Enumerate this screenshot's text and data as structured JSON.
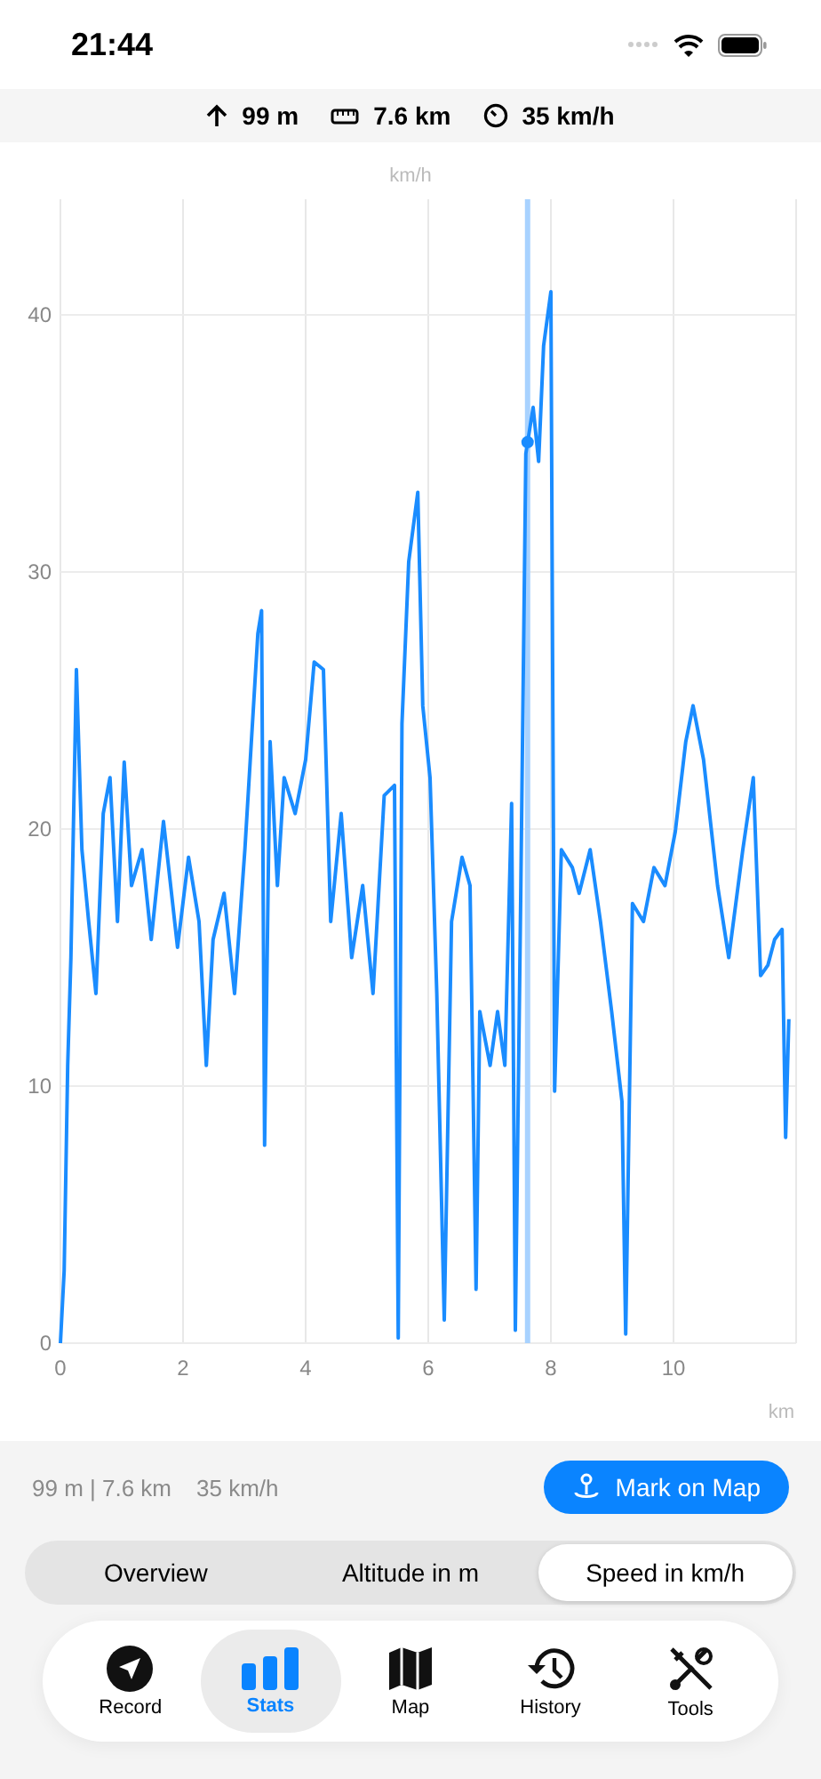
{
  "status_bar": {
    "time": "21:44"
  },
  "summary": [
    {
      "kind": "altitude",
      "text": "99 m"
    },
    {
      "kind": "distance",
      "text": "7.6 km"
    },
    {
      "kind": "speed",
      "text": "35 km/h"
    }
  ],
  "chart": {
    "chart_data": {
      "type": "line",
      "ylabel": "km/h",
      "xlabel": "km",
      "x": [
        0,
        0.06,
        0.12,
        0.17,
        0.26,
        0.35,
        0.46,
        0.58,
        0.7,
        0.81,
        0.93,
        1.04,
        1.16,
        1.33,
        1.48,
        1.68,
        1.91,
        2.09,
        2.26,
        2.38,
        2.49,
        2.67,
        2.84,
        3.01,
        3.22,
        3.28,
        3.33,
        3.42,
        3.54,
        3.65,
        3.83,
        4.0,
        4.14,
        4.29,
        4.41,
        4.58,
        4.75,
        4.93,
        5.1,
        5.28,
        5.45,
        5.51,
        5.57,
        5.68,
        5.83,
        5.91,
        6.03,
        6.14,
        6.26,
        6.38,
        6.55,
        6.68,
        6.78,
        6.84,
        7.01,
        7.13,
        7.25,
        7.36,
        7.42,
        7.51,
        7.59,
        7.71,
        7.8,
        7.88,
        8.0,
        8.06,
        8.17,
        8.35,
        8.46,
        8.64,
        8.81,
        8.99,
        9.16,
        9.22,
        9.33,
        9.51,
        9.68,
        9.86,
        10.03,
        10.2,
        10.32,
        10.49,
        10.72,
        10.9,
        11.13,
        11.3,
        11.42,
        11.54,
        11.65,
        11.77,
        11.83,
        11.88
      ],
      "series": [
        {
          "color": "#1a8cff",
          "values": [
            0,
            2.8,
            10.8,
            15,
            26.2,
            19.2,
            16.4,
            13.6,
            20.6,
            22,
            16.4,
            22.6,
            17.8,
            19.2,
            15.7,
            20.3,
            15.4,
            18.9,
            16.4,
            10.8,
            15.7,
            17.5,
            13.6,
            19.2,
            27.6,
            28.5,
            7.7,
            23.4,
            17.8,
            22,
            20.6,
            22.7,
            26.5,
            26.2,
            16.4,
            20.6,
            15,
            17.8,
            13.6,
            21.3,
            21.7,
            0.2,
            24.1,
            30.4,
            33.1,
            24.8,
            22,
            13.6,
            0.9,
            16.4,
            18.9,
            17.8,
            2.1,
            12.9,
            10.8,
            12.9,
            10.8,
            21,
            0.5,
            17.8,
            34.6,
            36.4,
            34.3,
            38.8,
            40.9,
            9.8,
            19.2,
            18.5,
            17.5,
            19.2,
            16.4,
            12.9,
            9.4,
            0.35,
            17.1,
            16.4,
            18.5,
            17.8,
            19.9,
            23.4,
            24.8,
            22.7,
            17.8,
            15,
            19.2,
            22,
            14.3,
            14.7,
            15.7,
            16.1,
            8,
            12.6
          ]
        }
      ],
      "xlim": [
        0,
        12
      ],
      "ylim": [
        0,
        44.5
      ],
      "xticks": [
        0,
        2,
        4,
        6,
        8,
        10
      ],
      "yticks": [
        0,
        10,
        20,
        30,
        40
      ],
      "grid": true,
      "ref_lines": [
        {
          "axis": "x",
          "value": 7.62
        }
      ]
    }
  },
  "info": {
    "position": "99 m | 7.6 km",
    "speed": "35 km/h"
  },
  "mark_button": "Mark on Map",
  "segments": [
    {
      "label": "Overview",
      "selected": false
    },
    {
      "label": "Altitude in m",
      "selected": false
    },
    {
      "label": "Speed in km/h",
      "selected": true
    }
  ],
  "tabs": [
    {
      "kind": "record",
      "label": "Record",
      "selected": false
    },
    {
      "kind": "stats",
      "label": "Stats",
      "selected": true
    },
    {
      "kind": "map",
      "label": "Map",
      "selected": false
    },
    {
      "kind": "history",
      "label": "History",
      "selected": false
    },
    {
      "kind": "tools",
      "label": "Tools",
      "selected": false
    }
  ]
}
